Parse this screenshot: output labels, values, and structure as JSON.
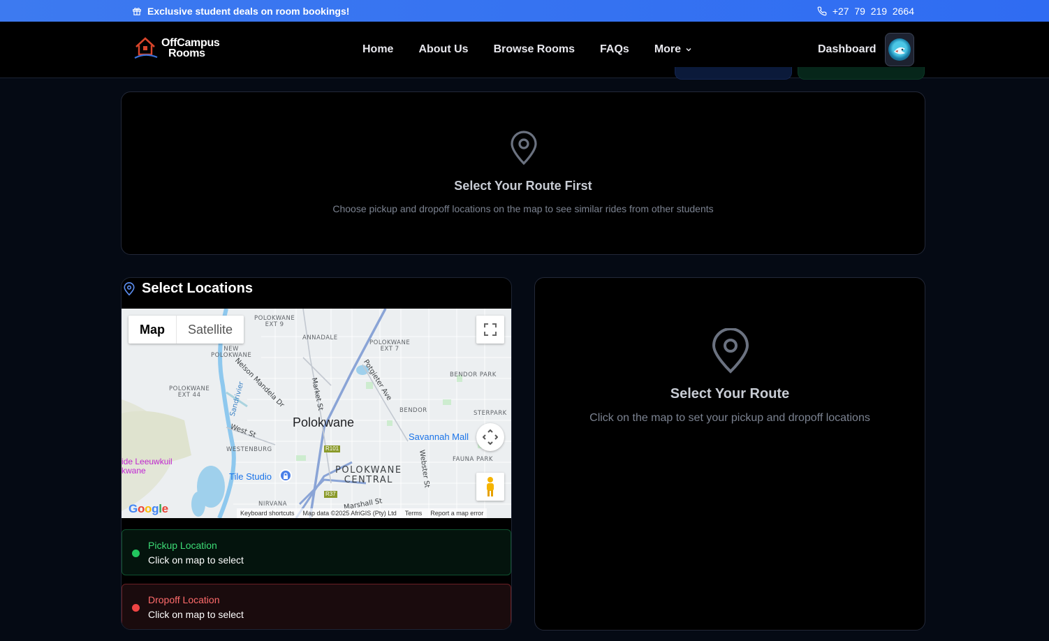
{
  "promo": {
    "message": "Exclusive student deals on room bookings!",
    "phone": "+27  79  219  2664"
  },
  "nav": {
    "logo_line1": "OffCampus",
    "logo_line2": "Rooms",
    "links": [
      "Home",
      "About Us",
      "Browse Rooms",
      "FAQs"
    ],
    "more_label": "More",
    "dashboard_label": "Dashboard"
  },
  "similar_rides": {
    "title": "Select Your Route First",
    "description": "Choose pickup and dropoff locations on the map to see similar rides from other students"
  },
  "select_locations": {
    "title": "Select Locations",
    "map": {
      "type_map": "Map",
      "type_satellite": "Satellite",
      "city_label": "Polokwane",
      "labels": {
        "polokwane_ext9": "POLOKWANE\nEXT 9",
        "annadale": "ANNADALE",
        "polokwane_ext7": "POLOKWANE\nEXT 7",
        "new_polokwane": "NEW\nPOLOKWANE",
        "bendor_park": "BENDOR PARK",
        "polokwane_ext44": "POLOKWANE\nEXT 44",
        "bendor": "BENDOR",
        "sterpark": "STERPARK",
        "westenburg": "WESTENBURG",
        "fauna_park": "FAUNA PARK",
        "polokwane_central": "POLOKWANE\nCENTRAL",
        "nirvana": "NIRVANA",
        "savannah_mall": "Savannah Mall",
        "tile_studio": "Tile Studio",
        "leeuwkuil": "ide Leeuwkuil\nkwane",
        "nelson_mandela": "Nelson Mandela Dr",
        "market_st": "Market St",
        "potgieter": "Potgieter Ave",
        "west_st": "West St",
        "webster": "Webster St",
        "marshall": "Marshall St",
        "sandrivier": "Sandrivier",
        "r101": "R101",
        "r37": "R37"
      },
      "attribution": {
        "shortcuts": "Keyboard shortcuts",
        "data": "Map data ©2025 AfriGIS (Pty) Ltd",
        "terms": "Terms",
        "report": "Report a map error"
      }
    },
    "pickup": {
      "label": "Pickup Location",
      "value": "Click on map to select"
    },
    "dropoff": {
      "label": "Dropoff Location",
      "value": "Click on map to select"
    }
  },
  "route": {
    "title": "Select Your Route",
    "description": "Click on the map to set your pickup and dropoff locations"
  },
  "colors": {
    "promo_bar": "#3d7af0",
    "background": "#050a14",
    "pickup_green": "#22c55e",
    "dropoff_red": "#ef4444"
  }
}
